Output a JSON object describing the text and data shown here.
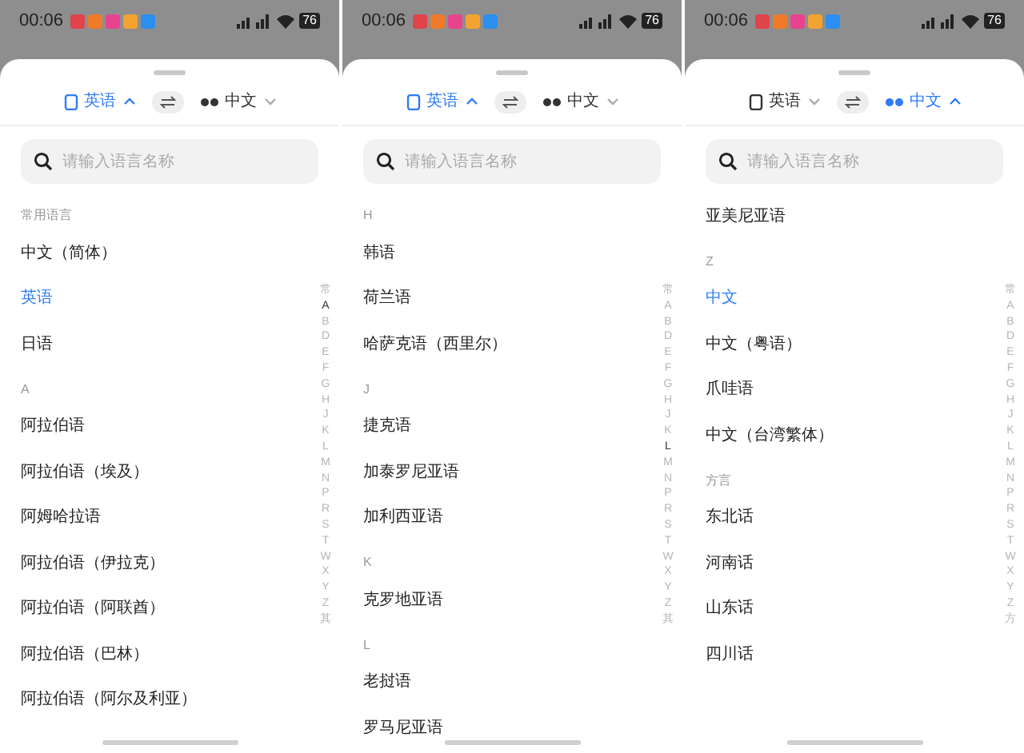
{
  "panels": [
    {
      "status_bar": {
        "time": "00:06",
        "battery": "76"
      },
      "source": {
        "label": "英语",
        "selected": true
      },
      "target": {
        "label": "中文",
        "selected": false
      },
      "search": {
        "placeholder": "请输入语言名称"
      },
      "list": [
        {
          "kind": "header",
          "label": "常用语言"
        },
        {
          "kind": "item",
          "label": "中文（简体）",
          "selected": false
        },
        {
          "kind": "item",
          "label": "英语",
          "selected": true
        },
        {
          "kind": "item",
          "label": "日语",
          "selected": false
        },
        {
          "kind": "header",
          "label": "A"
        },
        {
          "kind": "item",
          "label": "阿拉伯语",
          "selected": false
        },
        {
          "kind": "item",
          "label": "阿拉伯语（埃及）",
          "selected": false
        },
        {
          "kind": "item",
          "label": "阿姆哈拉语",
          "selected": false
        },
        {
          "kind": "item",
          "label": "阿拉伯语（伊拉克）",
          "selected": false
        },
        {
          "kind": "item",
          "label": "阿拉伯语（阿联酋）",
          "selected": false
        },
        {
          "kind": "item",
          "label": "阿拉伯语（巴林）",
          "selected": false
        },
        {
          "kind": "item",
          "label": "阿拉伯语（阿尔及利亚）",
          "selected": false
        }
      ],
      "index": [
        {
          "label": "常",
          "selected": false
        },
        {
          "label": "A",
          "selected": true
        },
        {
          "label": "B",
          "selected": false
        },
        {
          "label": "D",
          "selected": false
        },
        {
          "label": "E",
          "selected": false
        },
        {
          "label": "F",
          "selected": false
        },
        {
          "label": "G",
          "selected": false
        },
        {
          "label": "H",
          "selected": false
        },
        {
          "label": "J",
          "selected": false
        },
        {
          "label": "K",
          "selected": false
        },
        {
          "label": "L",
          "selected": false
        },
        {
          "label": "M",
          "selected": false
        },
        {
          "label": "N",
          "selected": false
        },
        {
          "label": "P",
          "selected": false
        },
        {
          "label": "R",
          "selected": false
        },
        {
          "label": "S",
          "selected": false
        },
        {
          "label": "T",
          "selected": false
        },
        {
          "label": "W",
          "selected": false
        },
        {
          "label": "X",
          "selected": false
        },
        {
          "label": "Y",
          "selected": false
        },
        {
          "label": "Z",
          "selected": false
        },
        {
          "label": "其",
          "selected": false
        }
      ]
    },
    {
      "status_bar": {
        "time": "00:06",
        "battery": "76"
      },
      "source": {
        "label": "英语",
        "selected": true
      },
      "target": {
        "label": "中文",
        "selected": false
      },
      "search": {
        "placeholder": "请输入语言名称"
      },
      "list": [
        {
          "kind": "header",
          "label": "H"
        },
        {
          "kind": "item",
          "label": "韩语",
          "selected": false
        },
        {
          "kind": "item",
          "label": "荷兰语",
          "selected": false
        },
        {
          "kind": "item",
          "label": "哈萨克语（西里尔）",
          "selected": false
        },
        {
          "kind": "header",
          "label": "J"
        },
        {
          "kind": "item",
          "label": "捷克语",
          "selected": false
        },
        {
          "kind": "item",
          "label": "加泰罗尼亚语",
          "selected": false
        },
        {
          "kind": "item",
          "label": "加利西亚语",
          "selected": false
        },
        {
          "kind": "header",
          "label": "K"
        },
        {
          "kind": "item",
          "label": "克罗地亚语",
          "selected": false
        },
        {
          "kind": "header",
          "label": "L"
        },
        {
          "kind": "item",
          "label": "老挝语",
          "selected": false
        },
        {
          "kind": "item",
          "label": "罗马尼亚语",
          "selected": false
        }
      ],
      "index": [
        {
          "label": "常",
          "selected": false
        },
        {
          "label": "A",
          "selected": false
        },
        {
          "label": "B",
          "selected": false
        },
        {
          "label": "D",
          "selected": false
        },
        {
          "label": "E",
          "selected": false
        },
        {
          "label": "F",
          "selected": false
        },
        {
          "label": "G",
          "selected": false
        },
        {
          "label": "H",
          "selected": false
        },
        {
          "label": "J",
          "selected": false
        },
        {
          "label": "K",
          "selected": false
        },
        {
          "label": "L",
          "selected": true
        },
        {
          "label": "M",
          "selected": false
        },
        {
          "label": "N",
          "selected": false
        },
        {
          "label": "P",
          "selected": false
        },
        {
          "label": "R",
          "selected": false
        },
        {
          "label": "S",
          "selected": false
        },
        {
          "label": "T",
          "selected": false
        },
        {
          "label": "W",
          "selected": false
        },
        {
          "label": "X",
          "selected": false
        },
        {
          "label": "Y",
          "selected": false
        },
        {
          "label": "Z",
          "selected": false
        },
        {
          "label": "其",
          "selected": false
        }
      ]
    },
    {
      "status_bar": {
        "time": "00:06",
        "battery": "76"
      },
      "source": {
        "label": "英语",
        "selected": false
      },
      "target": {
        "label": "中文",
        "selected": true
      },
      "search": {
        "placeholder": "请输入语言名称"
      },
      "list": [
        {
          "kind": "item",
          "label": "亚美尼亚语",
          "selected": false
        },
        {
          "kind": "header",
          "label": "Z"
        },
        {
          "kind": "item",
          "label": "中文",
          "selected": true
        },
        {
          "kind": "item",
          "label": "中文（粤语）",
          "selected": false
        },
        {
          "kind": "item",
          "label": "爪哇语",
          "selected": false
        },
        {
          "kind": "item",
          "label": "中文（台湾繁体）",
          "selected": false
        },
        {
          "kind": "header",
          "label": "方言"
        },
        {
          "kind": "item",
          "label": "东北话",
          "selected": false
        },
        {
          "kind": "item",
          "label": "河南话",
          "selected": false
        },
        {
          "kind": "item",
          "label": "山东话",
          "selected": false
        },
        {
          "kind": "item",
          "label": "四川话",
          "selected": false
        }
      ],
      "index": [
        {
          "label": "常",
          "selected": false
        },
        {
          "label": "A",
          "selected": false
        },
        {
          "label": "B",
          "selected": false
        },
        {
          "label": "D",
          "selected": false
        },
        {
          "label": "E",
          "selected": false
        },
        {
          "label": "F",
          "selected": false
        },
        {
          "label": "G",
          "selected": false
        },
        {
          "label": "H",
          "selected": false
        },
        {
          "label": "J",
          "selected": false
        },
        {
          "label": "K",
          "selected": false
        },
        {
          "label": "L",
          "selected": false
        },
        {
          "label": "M",
          "selected": false
        },
        {
          "label": "N",
          "selected": false
        },
        {
          "label": "P",
          "selected": false
        },
        {
          "label": "R",
          "selected": false
        },
        {
          "label": "S",
          "selected": false
        },
        {
          "label": "T",
          "selected": false
        },
        {
          "label": "W",
          "selected": false
        },
        {
          "label": "X",
          "selected": false
        },
        {
          "label": "Y",
          "selected": false
        },
        {
          "label": "Z",
          "selected": false
        },
        {
          "label": "方",
          "selected": false
        }
      ]
    }
  ]
}
